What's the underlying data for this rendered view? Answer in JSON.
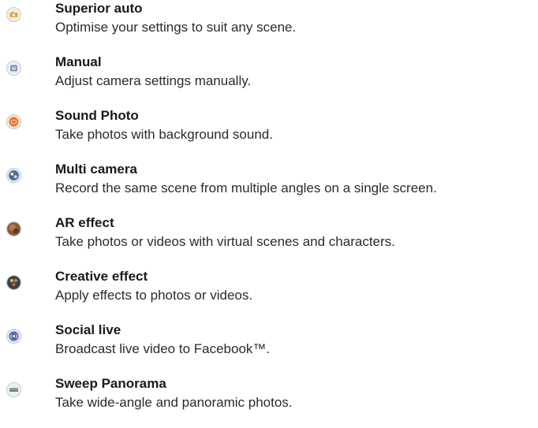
{
  "modes": [
    {
      "icon": "superior-auto-icon",
      "title": "Superior auto",
      "description": "Optimise your settings to suit any scene."
    },
    {
      "icon": "manual-icon",
      "title": "Manual",
      "description": "Adjust camera settings manually."
    },
    {
      "icon": "sound-photo-icon",
      "title": "Sound Photo",
      "description": "Take photos with background sound."
    },
    {
      "icon": "multi-camera-icon",
      "title": "Multi camera",
      "description": "Record the same scene from multiple angles on a single screen."
    },
    {
      "icon": "ar-effect-icon",
      "title": "AR effect",
      "description": "Take photos or videos with virtual scenes and characters."
    },
    {
      "icon": "creative-effect-icon",
      "title": "Creative effect",
      "description": "Apply effects to photos or videos."
    },
    {
      "icon": "social-live-icon",
      "title": "Social live",
      "description": "Broadcast live video to Facebook™."
    },
    {
      "icon": "sweep-panorama-icon",
      "title": "Sweep Panorama",
      "description": "Take wide-angle and panoramic photos."
    }
  ]
}
